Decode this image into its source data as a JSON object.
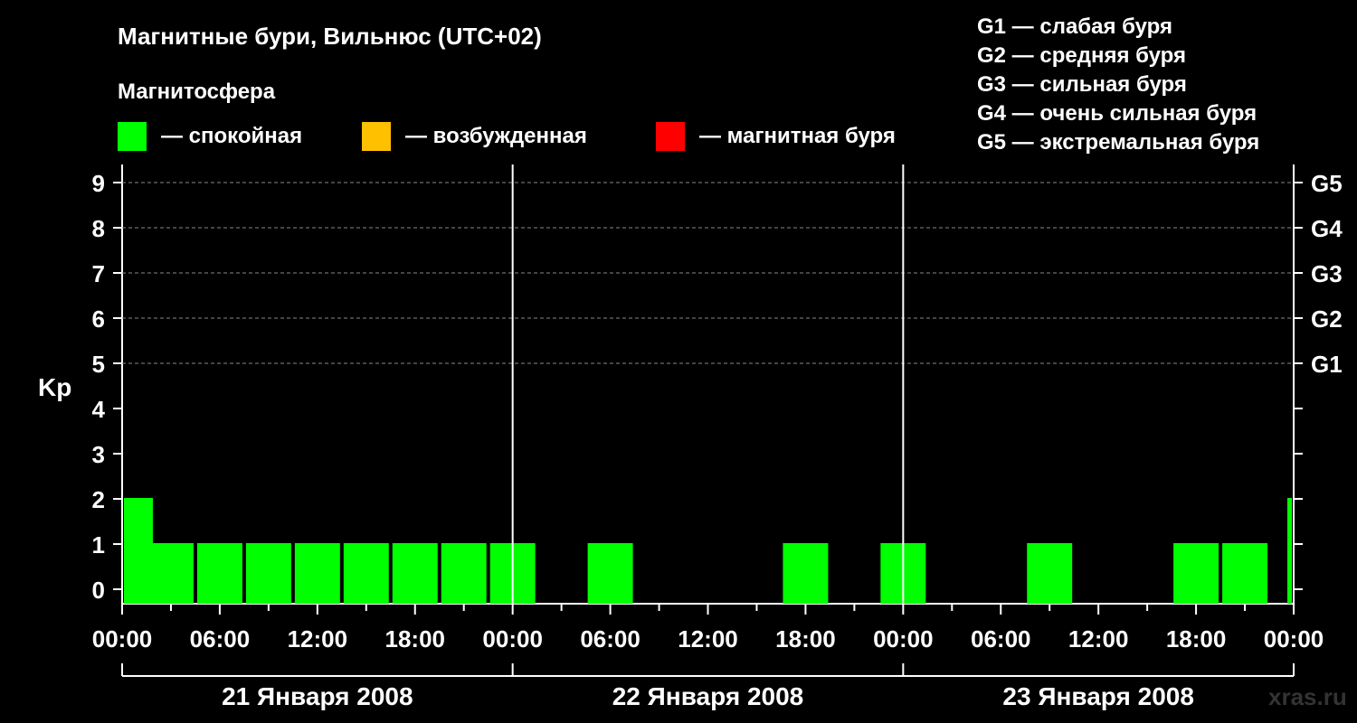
{
  "header": {
    "title": "Магнитные бури, Вильнюс (UTC+02)",
    "subtitle": "Магнитосфера"
  },
  "legend": [
    {
      "label": "— спокойная",
      "color": "#00ff00"
    },
    {
      "label": "— возбужденная",
      "color": "#ffc000"
    },
    {
      "label": "— магнитная буря",
      "color": "#ff0000"
    }
  ],
  "storm_scale": [
    "G1 — слабая буря",
    "G2 — средняя буря",
    "G3 — сильная буря",
    "G4 — очень сильная буря",
    "G5 — экстремальная буря"
  ],
  "watermark": "xras.ru",
  "chart_data": {
    "type": "bar",
    "ylabel": "Kp",
    "ylim": [
      0,
      9
    ],
    "y_ticks": [
      "0",
      "1",
      "2",
      "3",
      "4",
      "5",
      "6",
      "7",
      "8",
      "9"
    ],
    "g_levels": [
      {
        "label": "G1",
        "kp": 5
      },
      {
        "label": "G2",
        "kp": 6
      },
      {
        "label": "G3",
        "kp": 7
      },
      {
        "label": "G4",
        "kp": 8
      },
      {
        "label": "G5",
        "kp": 9
      }
    ],
    "x_ticks": [
      "00:00",
      "06:00",
      "12:00",
      "18:00",
      "00:00",
      "06:00",
      "12:00",
      "18:00",
      "00:00",
      "06:00",
      "12:00",
      "18:00",
      "00:00"
    ],
    "days": [
      "21 Января 2008",
      "22 Января 2008",
      "23 Января 2008"
    ],
    "grid": "dashed at Kp 5-9",
    "bar_color": "#00ff00",
    "bars": [
      {
        "start_hour": 0,
        "end_hour": 2,
        "kp": 2
      },
      {
        "start_hour": 1.5,
        "end_hour": 4.5,
        "kp": 1
      },
      {
        "start_hour": 4.5,
        "end_hour": 7.5,
        "kp": 1
      },
      {
        "start_hour": 7.5,
        "end_hour": 10.5,
        "kp": 1
      },
      {
        "start_hour": 10.5,
        "end_hour": 13.5,
        "kp": 1
      },
      {
        "start_hour": 13.5,
        "end_hour": 16.5,
        "kp": 1
      },
      {
        "start_hour": 16.5,
        "end_hour": 19.5,
        "kp": 1
      },
      {
        "start_hour": 19.5,
        "end_hour": 22.5,
        "kp": 1
      },
      {
        "start_hour": 22.5,
        "end_hour": 25.5,
        "kp": 1
      },
      {
        "start_hour": 25.5,
        "end_hour": 28.5,
        "kp": 0
      },
      {
        "start_hour": 28.5,
        "end_hour": 31.5,
        "kp": 1
      },
      {
        "start_hour": 31.5,
        "end_hour": 34.5,
        "kp": 0
      },
      {
        "start_hour": 34.5,
        "end_hour": 37.5,
        "kp": 0
      },
      {
        "start_hour": 37.5,
        "end_hour": 40.5,
        "kp": 0
      },
      {
        "start_hour": 40.5,
        "end_hour": 43.5,
        "kp": 1
      },
      {
        "start_hour": 43.5,
        "end_hour": 46.5,
        "kp": 0
      },
      {
        "start_hour": 46.5,
        "end_hour": 49.5,
        "kp": 1
      },
      {
        "start_hour": 49.5,
        "end_hour": 52.5,
        "kp": 0
      },
      {
        "start_hour": 52.5,
        "end_hour": 55.5,
        "kp": 0
      },
      {
        "start_hour": 55.5,
        "end_hour": 58.5,
        "kp": 1
      },
      {
        "start_hour": 58.5,
        "end_hour": 61.5,
        "kp": 0
      },
      {
        "start_hour": 61.5,
        "end_hour": 64.5,
        "kp": 0
      },
      {
        "start_hour": 64.5,
        "end_hour": 67.5,
        "kp": 1
      },
      {
        "start_hour": 67.5,
        "end_hour": 70.5,
        "kp": 1
      },
      {
        "start_hour": 71.5,
        "end_hour": 72,
        "kp": 2
      }
    ]
  }
}
